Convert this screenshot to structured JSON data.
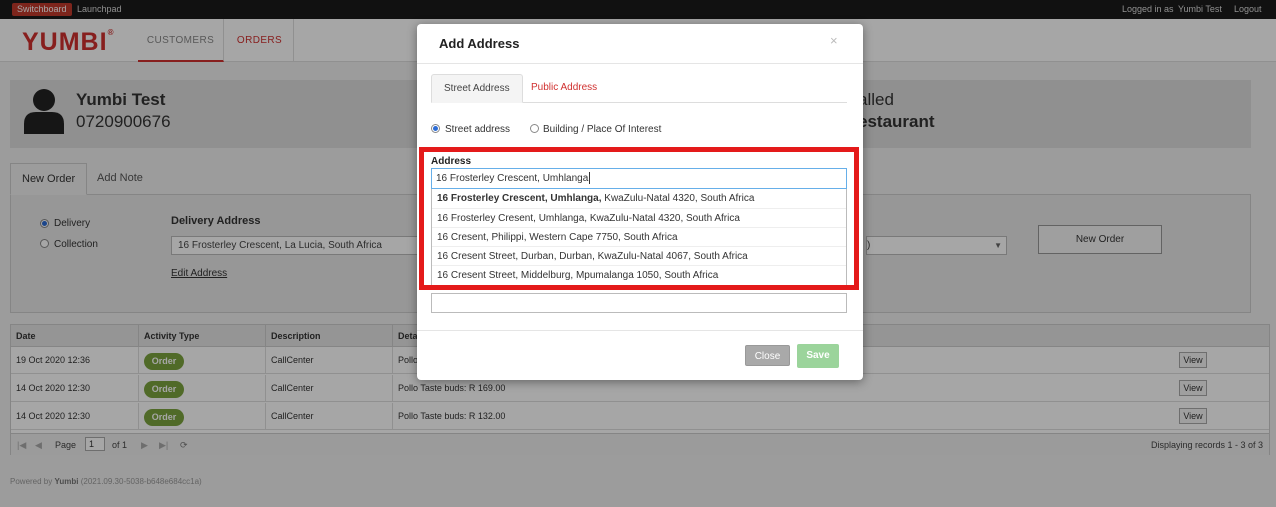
{
  "topbar": {
    "switchboard": "Switchboard",
    "launchpad": "Launchpad",
    "logged_in_as": "Logged in as",
    "user": "Yumbi Test",
    "logout": "Logout"
  },
  "header": {
    "logo": "YUMBI",
    "logo_mark": "®",
    "nav": {
      "customers": "CUSTOMERS",
      "orders": "ORDERS"
    }
  },
  "customer": {
    "name": "Yumbi Test",
    "phone": "0720900676",
    "right_line1": "alled",
    "right_line2": "estaurant"
  },
  "order_tabs": {
    "new_order": "New Order",
    "add_note": "Add Note"
  },
  "order_panel": {
    "delivery": "Delivery",
    "collection": "Collection",
    "delivery_address_title": "Delivery Address",
    "delivery_address_value": "16 Frosterley Crescent, La Lucia, South Africa",
    "edit_address": "Edit Address",
    "right_select_value": ")",
    "new_order_button": "New Order"
  },
  "grid": {
    "columns": [
      "Date",
      "Activity Type",
      "Description",
      "Deta"
    ],
    "rows": [
      {
        "date": "19 Oct 2020 12:36",
        "activity": "Order",
        "description": "CallCenter",
        "details": "Pollo",
        "view": "View"
      },
      {
        "date": "14 Oct 2020 12:30",
        "activity": "Order",
        "description": "CallCenter",
        "details": "Pollo Taste buds: R 169.00",
        "view": "View"
      },
      {
        "date": "14 Oct 2020 12:30",
        "activity": "Order",
        "description": "CallCenter",
        "details": "Pollo Taste buds: R 132.00",
        "view": "View"
      }
    ],
    "pager": {
      "page_label": "Page",
      "page_value": "1",
      "of_label": "of 1",
      "displaying": "Displaying records 1 - 3 of 3"
    }
  },
  "footer": {
    "powered_by": "Powered by",
    "brand": "Yumbi",
    "version": "(2021.09.30-5038-b648e684cc1a)"
  },
  "modal": {
    "title": "Add Address",
    "close_icon": "×",
    "tabs": {
      "street": "Street Address",
      "public": "Public Address"
    },
    "radio_street": "Street address",
    "radio_building": "Building / Place Of Interest",
    "address_label": "Address",
    "address_value": "16 Frosterley Crescent, Umhlanga",
    "suggestions": [
      {
        "bold": "16 Frosterley Crescent, Umhlanga,",
        "rest": " KwaZulu-Natal 4320, South Africa"
      },
      {
        "bold": "",
        "rest": "16 Frosterley Cresent, Umhlanga, KwaZulu-Natal 4320, South Africa"
      },
      {
        "bold": "",
        "rest": "16 Cresent, Philippi, Western Cape 7750, South Africa"
      },
      {
        "bold": "",
        "rest": "16 Cresent Street, Durban, Durban, KwaZulu-Natal 4067, South Africa"
      },
      {
        "bold": "",
        "rest": "16 Cresent Street, Middelburg, Mpumalanga 1050, South Africa"
      }
    ],
    "close_button": "Close",
    "save_button": "Save"
  },
  "colors": {
    "brand_red": "#d0302f",
    "highlight_red": "#e41a1a",
    "badge_green": "#7ba33e",
    "save_green": "#9bd49b"
  }
}
